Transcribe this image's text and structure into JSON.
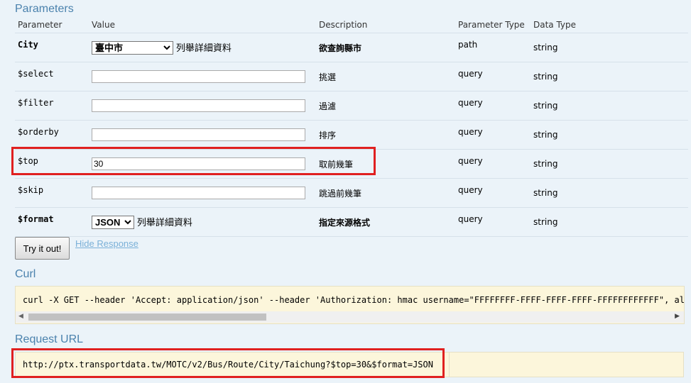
{
  "parameters_title": "Parameters",
  "columns": {
    "parameter": "Parameter",
    "value": "Value",
    "description": "Description",
    "parameter_type": "Parameter Type",
    "data_type": "Data Type"
  },
  "rows": [
    {
      "name": "City",
      "value": "臺中市",
      "description": "欲查詢縣市",
      "ptype": "path",
      "dtype": "string",
      "list_link": "列舉詳細資料"
    },
    {
      "name": "$select",
      "value": "",
      "description": "挑選",
      "ptype": "query",
      "dtype": "string"
    },
    {
      "name": "$filter",
      "value": "",
      "description": "過濾",
      "ptype": "query",
      "dtype": "string"
    },
    {
      "name": "$orderby",
      "value": "",
      "description": "排序",
      "ptype": "query",
      "dtype": "string"
    },
    {
      "name": "$top",
      "value": "30",
      "description": "取前幾筆",
      "ptype": "query",
      "dtype": "string"
    },
    {
      "name": "$skip",
      "value": "",
      "description": "跳過前幾筆",
      "ptype": "query",
      "dtype": "string"
    },
    {
      "name": "$format",
      "value": "JSON",
      "description": "指定來源格式",
      "ptype": "query",
      "dtype": "string",
      "list_link": "列舉詳細資料"
    }
  ],
  "try_button": "Try it out!",
  "hide_response": "Hide Response",
  "curl_title": "Curl",
  "curl_command": "curl -X GET --header 'Accept: application/json' --header 'Authorization: hmac username=\"FFFFFFFF-FFFF-FFFF-FFFF-FFFFFFFFFFFF\", alg",
  "request_url_title": "Request URL",
  "request_url": "http://ptx.transportdata.tw/MOTC/v2/Bus/Route/City/Taichung?$top=30&$format=JSON",
  "colors": {
    "title": "#4b82ad",
    "highlight": "#e02020",
    "code_bg": "#fcf6db",
    "page_bg": "#ebf3f9"
  }
}
